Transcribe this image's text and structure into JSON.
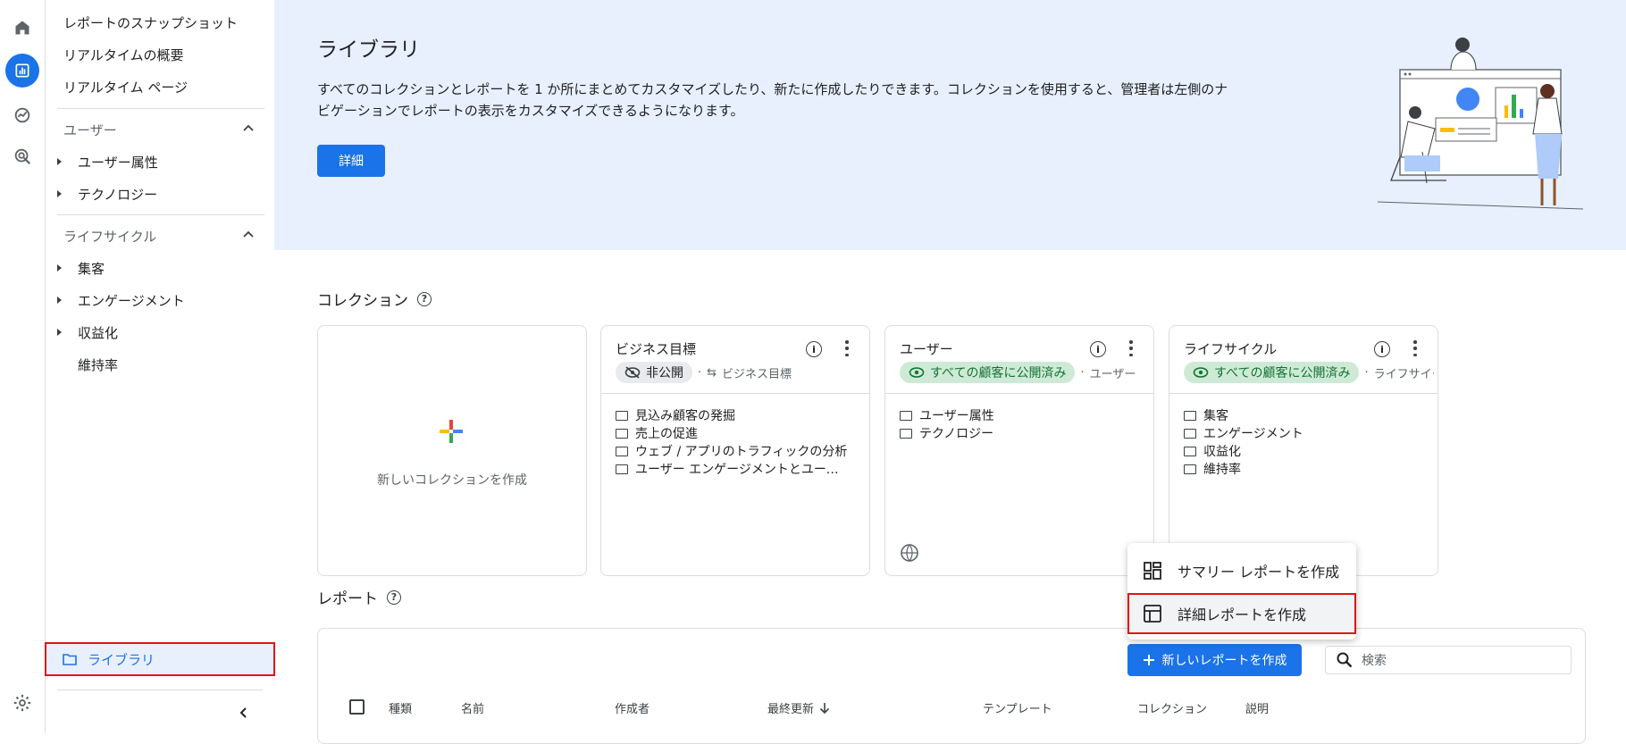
{
  "rail": {
    "icons": [
      "home-icon",
      "reports-icon",
      "explore-icon",
      "advertising-icon",
      "settings-icon"
    ]
  },
  "nav": {
    "items": [
      "レポートのスナップショット",
      "リアルタイムの概要",
      "リアルタイム ページ"
    ],
    "user_section": {
      "label": "ユーザー",
      "items": [
        "ユーザー属性",
        "テクノロジー"
      ]
    },
    "lifecycle_section": {
      "label": "ライフサイクル",
      "items": [
        "集客",
        "エンゲージメント",
        "収益化",
        "維持率"
      ]
    },
    "library_label": "ライブラリ"
  },
  "banner": {
    "title": "ライブラリ",
    "description": "すべてのコレクションとレポートを 1 か所にまとめてカスタマイズしたり、新たに作成したりできます。コレクションを使用すると、管理者は左側のナビゲーションでレポートの表示をカスタマイズできるようになります。",
    "details_button": "詳細"
  },
  "collections": {
    "title": "コレクション",
    "new_label": "新しいコレクションを作成",
    "cards": [
      {
        "title": "ビジネス目標",
        "badge": "非公開",
        "template": "ビジネス目標",
        "items": [
          "見込み顧客の発掘",
          "売上の促進",
          "ウェブ / アプリのトラフィックの分析",
          "ユーザー エンゲージメントとユーザー維持率の確認"
        ]
      },
      {
        "title": "ユーザー",
        "badge": "すべての顧客に公開済み",
        "template": "ユーザー",
        "items": [
          "ユーザー属性",
          "テクノロジー"
        ]
      },
      {
        "title": "ライフサイクル",
        "badge": "すべての顧客に公開済み",
        "template": "ライフサイクル",
        "items": [
          "集客",
          "エンゲージメント",
          "収益化",
          "維持率"
        ]
      }
    ]
  },
  "reports": {
    "title": "レポート",
    "new_button": "新しいレポートを作成",
    "search_placeholder": "検索",
    "columns": [
      "種類",
      "名前",
      "作成者",
      "最終更新",
      "テンプレート",
      "コレクション",
      "説明"
    ]
  },
  "menu": {
    "items": [
      "サマリー レポートを作成",
      "詳細レポートを作成"
    ]
  },
  "colors": {
    "accent": "#1a73e8",
    "banner_bg": "#e8f0fe",
    "highlight_border": "#e01515",
    "published_bg": "#ceead6",
    "published_text": "#137333"
  }
}
